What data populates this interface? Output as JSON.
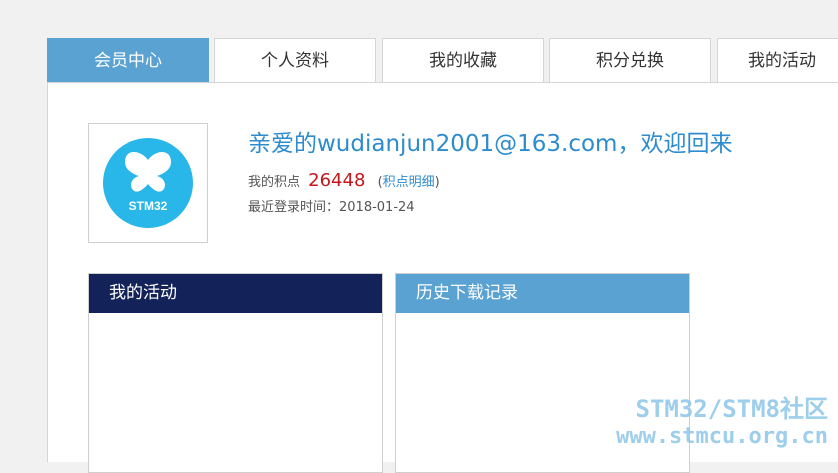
{
  "tabs": [
    {
      "label": "会员中心",
      "active": true
    },
    {
      "label": "个人资料",
      "active": false
    },
    {
      "label": "我的收藏",
      "active": false
    },
    {
      "label": "积分兑换",
      "active": false
    },
    {
      "label": "我的活动",
      "active": false
    }
  ],
  "profile": {
    "avatar_text": "STM32",
    "welcome": "亲爱的wudianjun2001@163.com，欢迎回来",
    "points_label": "我的积点",
    "points_value": "26448",
    "points_link_open": "(",
    "points_link": "积点明细",
    "points_link_close": ")",
    "last_login_label": "最近登录时间：",
    "last_login_date": "2018-01-24"
  },
  "sections": [
    {
      "title": "我的活动",
      "header_color": "#13235a"
    },
    {
      "title": "历史下载记录",
      "header_color": "#5aa2d1"
    }
  ],
  "watermark": {
    "line1": "STM32/STM8社区",
    "line2": "www.stmcu.org.cn"
  },
  "colors": {
    "accent": "#5aa2d1",
    "link": "#2d8ccd",
    "points": "#c4161c",
    "avatar_circle": "#29b6e8"
  }
}
